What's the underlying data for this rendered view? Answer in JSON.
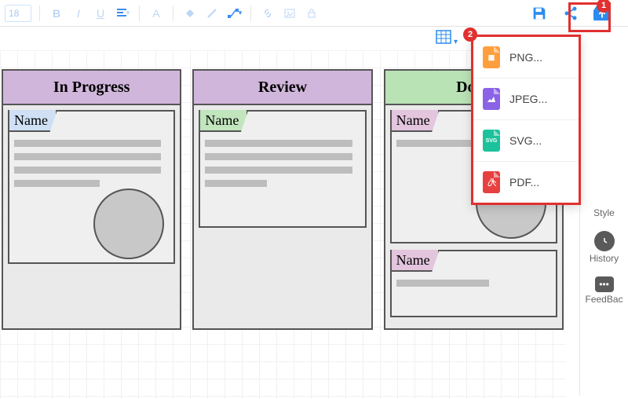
{
  "toolbar": {
    "font_size": "18",
    "bold": "B",
    "italic": "I",
    "underline": "U"
  },
  "board": {
    "columns": [
      {
        "title": "In Progress",
        "header_color": "purple",
        "cards": [
          {
            "tag": "Name",
            "tag_color": "blue-tag",
            "lines": 4,
            "circle": true
          }
        ]
      },
      {
        "title": "Review",
        "header_color": "purple",
        "cards": [
          {
            "tag": "Name",
            "tag_color": "green-tag",
            "lines": 4,
            "circle": false
          }
        ]
      },
      {
        "title": "Done",
        "header_color": "green-h",
        "cards": [
          {
            "tag": "Name",
            "tag_color": "pink-tag",
            "lines": 1,
            "circle": true
          },
          {
            "tag": "Name",
            "tag_color": "pink-tag",
            "lines": 1,
            "circle": false
          }
        ]
      }
    ]
  },
  "export_menu": {
    "items": [
      {
        "label": "PNG...",
        "icon": "png"
      },
      {
        "label": "JPEG...",
        "icon": "jpeg"
      },
      {
        "label": "SVG...",
        "icon": "svg"
      },
      {
        "label": "PDF...",
        "icon": "pdf"
      }
    ]
  },
  "sidebar": {
    "style": "Style",
    "history": "History",
    "feedback": "FeedBac"
  },
  "annotations": {
    "badge1": "1",
    "badge2": "2"
  }
}
